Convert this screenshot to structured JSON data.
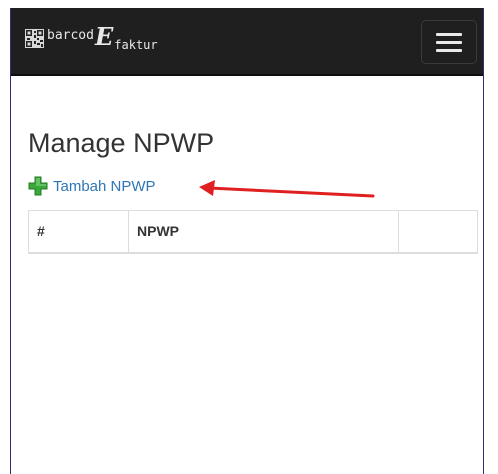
{
  "navbar": {
    "brand_part1": "barcod",
    "brand_e": "E",
    "brand_part2": "faktur",
    "qr_icon": "qr-code-icon",
    "menu_icon": "hamburger-menu-icon"
  },
  "main": {
    "title": "Manage NPWP",
    "add_link_label": "Tambah NPWP",
    "add_icon": "green-plus-icon",
    "annotation": "red-arrow"
  },
  "table": {
    "headers": [
      "#",
      "NPWP",
      ""
    ]
  },
  "colors": {
    "navbar_bg": "#1f1f1f",
    "link": "#2f77b4",
    "plus_green": "#3aa83a",
    "arrow_red": "#e02020"
  }
}
